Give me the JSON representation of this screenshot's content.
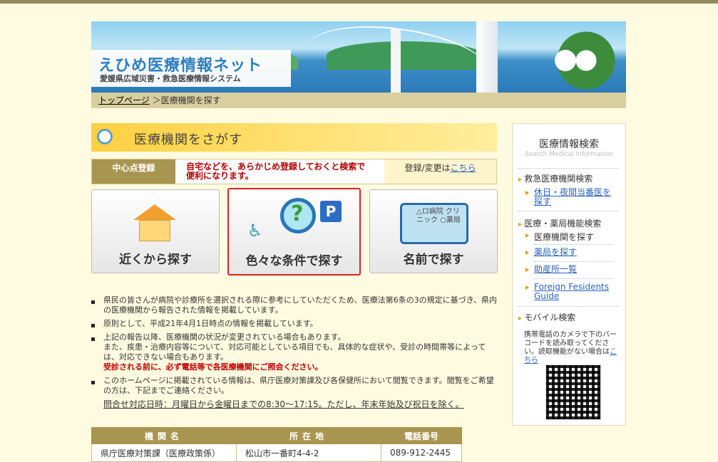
{
  "header": {
    "logo_title": "えひめ医療情報ネット",
    "logo_sub": "愛媛県広域災害・救急医療情報システム"
  },
  "breadcrumb": {
    "home": "トップページ",
    "sep": "＞",
    "current": "医療機関を探す"
  },
  "main": {
    "title": "医療機関をさがす",
    "register": {
      "label": "中心点登録",
      "message": "自宅などを、あらかじめ登録しておくと検索で便利になります。",
      "right_text": "登録/変更は",
      "right_link": "こちら"
    },
    "buttons": [
      {
        "label": "近くから探す"
      },
      {
        "label": "色々な条件で探す",
        "p_icon": "P"
      },
      {
        "label": "名前で探す",
        "book_text": "△ロ病院 クリニック ○薬局"
      }
    ],
    "notes": [
      "県民の皆さんが病院や診療所を選択される際に参考にしていただくため、医療法第6条の3の規定に基づき、県内の医療機関から報告された情報を掲載しています。",
      "原則として、平成21年4月1日時点の情報を掲載しています。",
      "上記の報告以降、医療機関の状況が変更されている場合もあります。",
      "また、疾患・治療内容等について、対応可能としている項目でも、具体的な症状や、受診の時間帯等によっては、対応できない場合もあります。",
      "受診される前に、必ず電話等で各医療機関にご照会ください。",
      "このホームページに掲載されている情報は、県庁医療対策課及び各保健所において閲覧できます。閲覧をご希望の方は、下記までご連絡ください。"
    ],
    "contact_hours": "問合せ対応日時：月曜日から金曜日までの8:30〜17:15。ただし、年末年始及び祝日を除く。",
    "table": {
      "headers": [
        "機関名",
        "所在地",
        "電話番号"
      ],
      "rows": [
        [
          "県庁医療対策課（医療政策係）",
          "松山市一番町4-4-2",
          "089-912-2445"
        ]
      ]
    }
  },
  "sidebar": {
    "title": "医療情報検索",
    "subtitle": "Search Medical Information",
    "sections": [
      {
        "label": "救急医療機関検索"
      },
      {
        "label": "医療・薬局機能検索"
      },
      {
        "label": "モバイル検索"
      }
    ],
    "items": [
      {
        "label": "休日・夜間当番医を探す"
      },
      {
        "label": "医療機関を探す"
      },
      {
        "label": "薬局を探す"
      },
      {
        "label": "助産所一覧"
      },
      {
        "label": "Foreign Fesidents Guide"
      }
    ],
    "mobile_text": "携帯電話のカメラで下のバーコードを読み取ってください。読取機能がない場合は",
    "mobile_link": "こちら"
  },
  "colors": {
    "accent": "#a89550",
    "link": "#2a62c0",
    "title_bar": "#ffd040",
    "alert": "#c00000"
  }
}
